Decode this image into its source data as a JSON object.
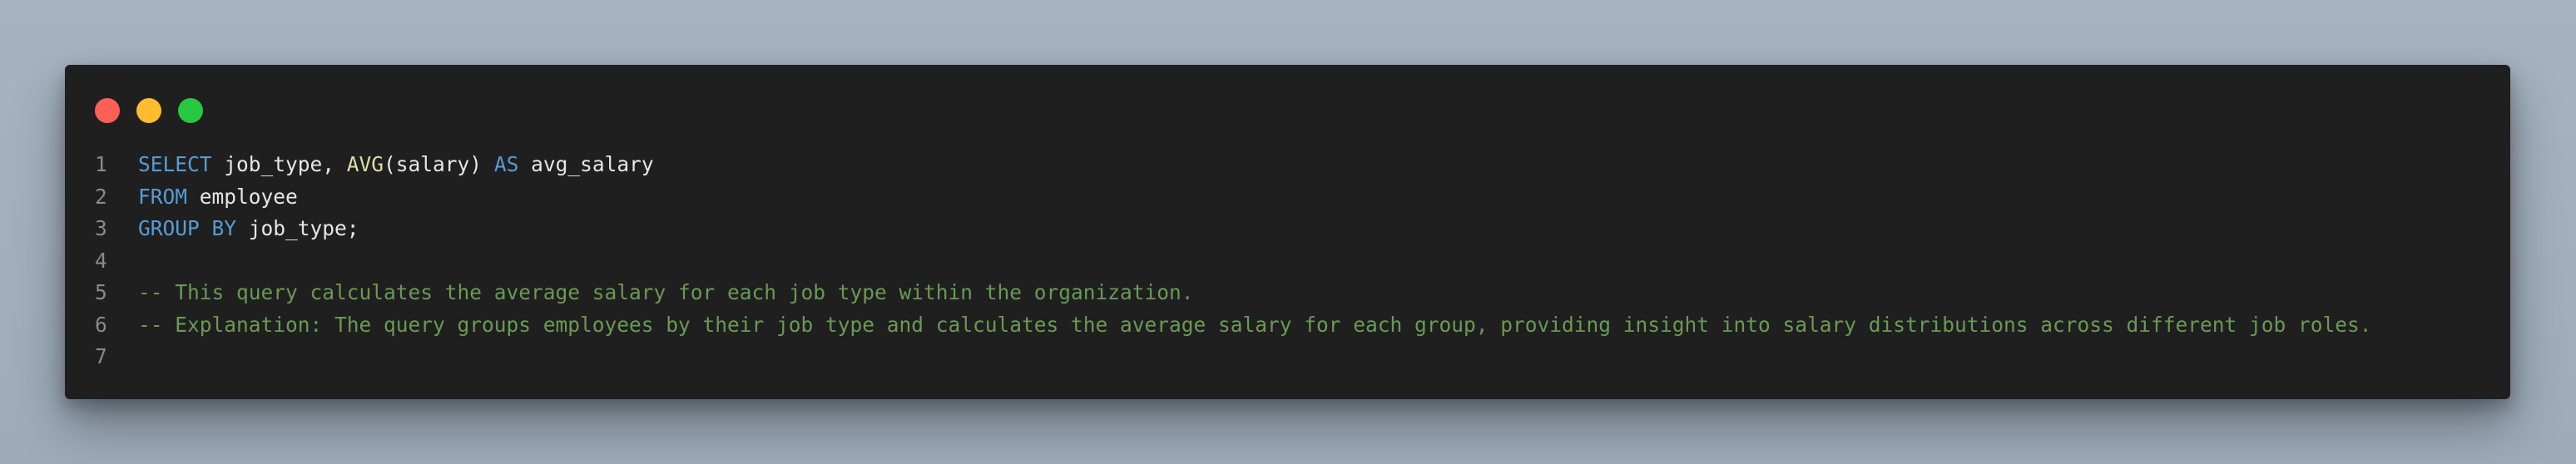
{
  "window": {
    "traffic_lights": [
      "close",
      "minimize",
      "maximize"
    ],
    "colors": {
      "background": "#1f1f1f",
      "keyword": "#569cd6",
      "function": "#dcdcaa",
      "comment": "#6a9955",
      "identifier": "#e6e6e6",
      "line_number": "#8a8a8a"
    }
  },
  "code": {
    "language": "sql",
    "lines": [
      {
        "number": "1",
        "tokens": [
          {
            "type": "kw",
            "text": "SELECT"
          },
          {
            "type": "id",
            "text": " job_type, "
          },
          {
            "type": "fn",
            "text": "AVG"
          },
          {
            "type": "id",
            "text": "(salary) "
          },
          {
            "type": "kw",
            "text": "AS"
          },
          {
            "type": "id",
            "text": " avg_salary"
          }
        ]
      },
      {
        "number": "2",
        "tokens": [
          {
            "type": "kw",
            "text": "FROM"
          },
          {
            "type": "id",
            "text": " employee"
          }
        ]
      },
      {
        "number": "3",
        "tokens": [
          {
            "type": "kw",
            "text": "GROUP BY"
          },
          {
            "type": "id",
            "text": " job_type;"
          }
        ]
      },
      {
        "number": "4",
        "tokens": []
      },
      {
        "number": "5",
        "tokens": [
          {
            "type": "cm",
            "text": "-- This query calculates the average salary for each job type within the organization."
          }
        ]
      },
      {
        "number": "6",
        "tokens": [
          {
            "type": "cm",
            "text": "-- Explanation: The query groups employees by their job type and calculates the average salary for each group, providing insight into salary distributions across different job roles."
          }
        ]
      },
      {
        "number": "7",
        "tokens": []
      }
    ]
  }
}
